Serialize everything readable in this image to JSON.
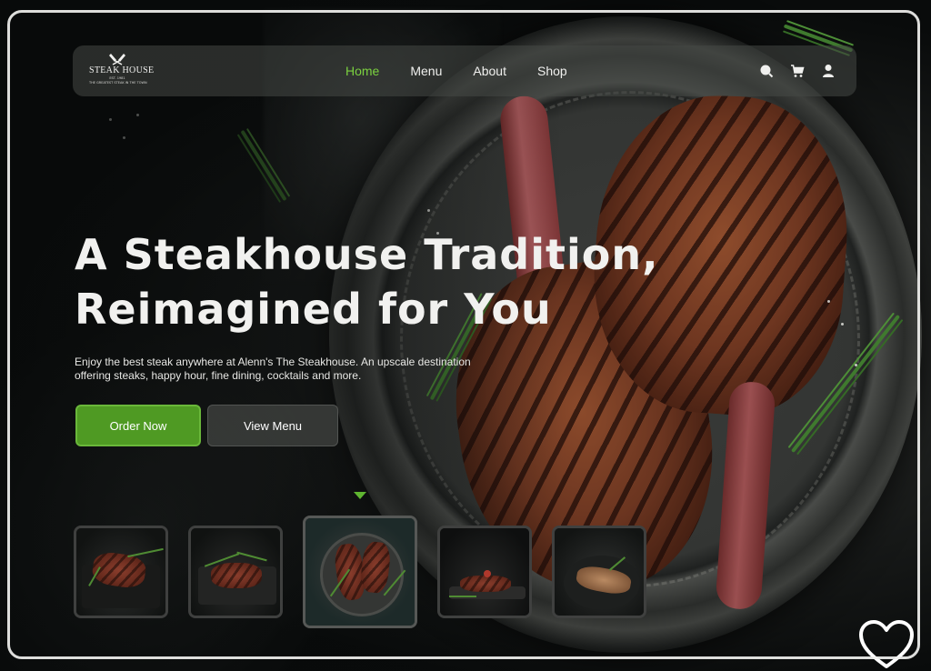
{
  "brand": {
    "name": "STEAK HOUSE",
    "tagline_1": "EST. 1981",
    "tagline_2": "THE GREATEST STEAK IN THE TOWN"
  },
  "nav": {
    "links": [
      {
        "label": "Home",
        "active": true
      },
      {
        "label": "Menu",
        "active": false
      },
      {
        "label": "About",
        "active": false
      },
      {
        "label": "Shop",
        "active": false
      }
    ],
    "icons": [
      "search-icon",
      "cart-icon",
      "user-icon"
    ]
  },
  "hero": {
    "title_line1": "A Steakhouse Tradition,",
    "title_line2": "Reimagined for You",
    "description": "Enjoy the best steak anywhere at Alenn's The Steakhouse. An upscale destination offering steaks, happy hour, fine dining, cocktails and more.",
    "primary_button": "Order Now",
    "secondary_button": "View Menu"
  },
  "thumbnails": {
    "count": 5,
    "active_index": 2
  },
  "colors": {
    "accent": "#5fb530",
    "button_primary": "#4f9a23",
    "text": "#f1f1ef",
    "background": "#0d1110"
  },
  "favorite": {
    "icon": "heart-icon"
  }
}
